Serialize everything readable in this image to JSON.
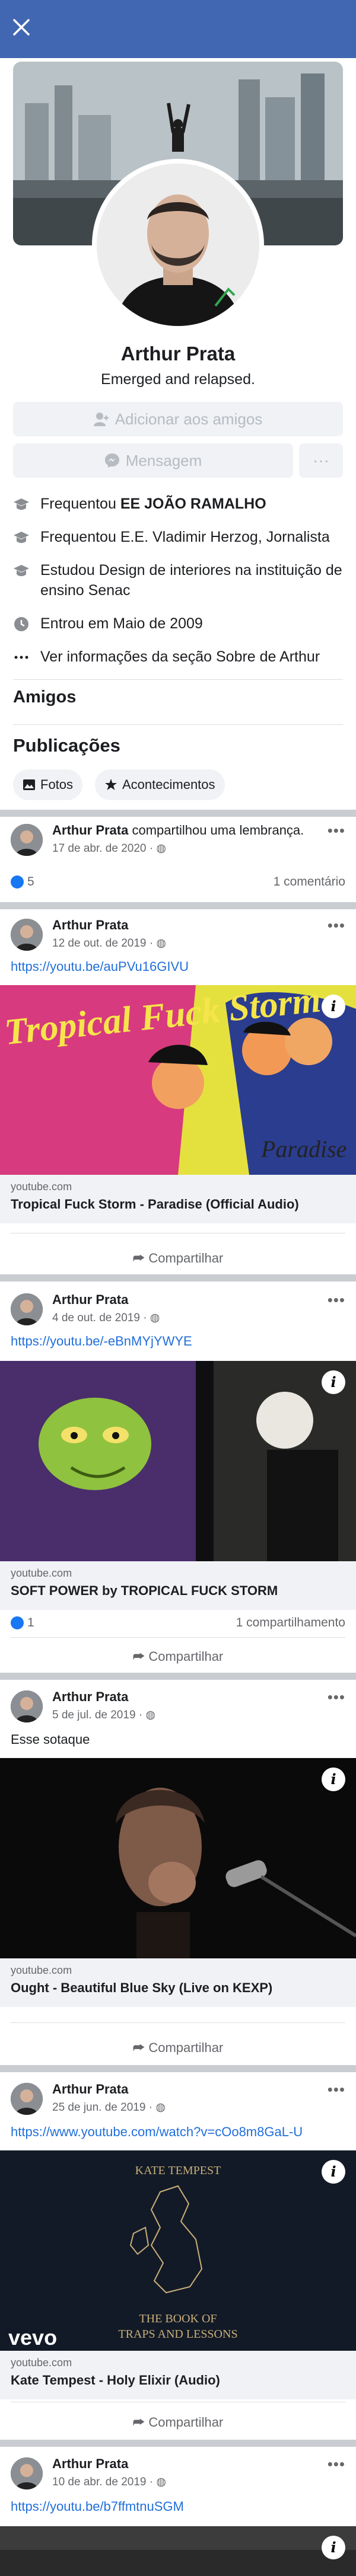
{
  "profile": {
    "name": "Arthur Prata",
    "bio": "Emerged and relapsed.",
    "add_friend": "Adicionar aos amigos",
    "message": "Mensagem",
    "more": "···"
  },
  "about": {
    "school1_prefix": "Frequentou ",
    "school1_name": "EE JOÃO RAMALHO",
    "school2": "Frequentou E.E. Vladimir Herzog, Jornalista",
    "study": "Estudou Design de interiores na instituição de ensino Senac",
    "joined": "Entrou em Maio de 2009",
    "see_more": "Ver informações da seção Sobre de Arthur"
  },
  "sections": {
    "friends": "Amigos",
    "posts": "Publicações",
    "photos_chip": "Fotos",
    "events_chip": "Acontecimentos"
  },
  "posts": [
    {
      "author": "Arthur Prata",
      "action": " compartilhou uma lembrança.",
      "date": "17 de abr. de 2020 · ",
      "likes": "5",
      "comments": "1 comentário"
    },
    {
      "author": "Arthur Prata",
      "date": "12 de out. de 2019 · ",
      "link": "https://youtu.be/auPVu16GIVU",
      "domain": "youtube.com",
      "title": "Tropical Fuck Storm - Paradise (Official Audio)",
      "share": "Compartilhar",
      "art_title": "Tropical Fuck Storm",
      "art_sub": "Paradise"
    },
    {
      "author": "Arthur Prata",
      "date": "4 de out. de 2019 · ",
      "link": "https://youtu.be/-eBnMYjYWYE",
      "domain": "youtube.com",
      "title": "SOFT POWER by TROPICAL FUCK STORM",
      "likes": "1",
      "shares": "1 compartilhamento",
      "share": "Compartilhar"
    },
    {
      "author": "Arthur Prata",
      "date": "5 de jul. de 2019 · ",
      "text": "Esse sotaque",
      "domain": "youtube.com",
      "title": "Ought - Beautiful Blue Sky (Live on KEXP)",
      "share": "Compartilhar"
    },
    {
      "author": "Arthur Prata",
      "date": "25 de jun. de 2019 · ",
      "link": "https://www.youtube.com/watch?v=cOo8m8GaL-U",
      "domain": "youtube.com",
      "title": "Kate Tempest - Holy Elixir (Audio)",
      "share": "Compartilhar",
      "art_top": "KATE TEMPEST",
      "art_bottom1": "THE BOOK OF",
      "art_bottom2": "TRAPS AND LESSONS",
      "vevo": "vevo"
    },
    {
      "author": "Arthur Prata",
      "date": "10 de abr. de 2019 · ",
      "link": "https://youtu.be/b7ffmtnuSGM"
    }
  ],
  "colors": {
    "brand": "#4267b2",
    "link": "#216fdb",
    "muted": "#65676b",
    "like": "#1877f2"
  },
  "icons": [
    "close-icon",
    "add-friend-icon",
    "messenger-icon",
    "graduation-cap-icon",
    "clock-icon",
    "dots-icon",
    "globe-icon",
    "photo-icon",
    "events-icon",
    "share-icon",
    "info-icon",
    "like-icon"
  ]
}
